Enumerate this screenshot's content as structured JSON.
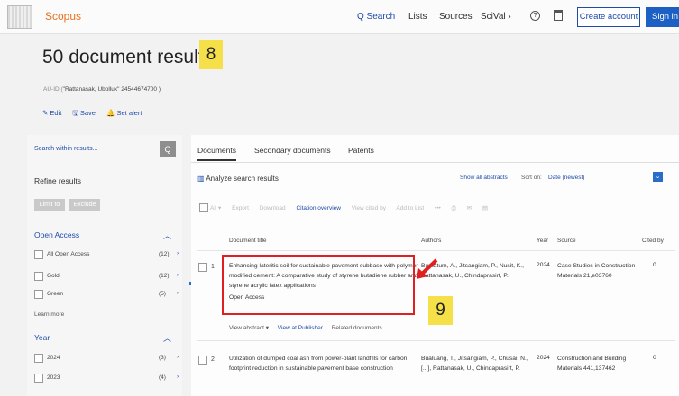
{
  "header": {
    "brand": "Scopus",
    "nav": {
      "search": "Q Search",
      "lists": "Lists",
      "sources": "Sources",
      "scival": "SciVal ›"
    },
    "create_account": "Create account",
    "sign_in": "Sign in"
  },
  "page": {
    "title": "50 document results",
    "step_badge": "8",
    "query_prefix": "AU-ID (",
    "query": "\"Rattanasak, Ubolluk\" 24544674700 )",
    "actions": {
      "edit": "✎ Edit",
      "save": "🖫 Save",
      "set_alert": "🔔 Set alert"
    }
  },
  "sidebar": {
    "search_placeholder": "Search within results...",
    "search_icon": "Q",
    "refine_title": "Refine results",
    "limit_to": "Limit to",
    "exclude": "Exclude",
    "open_access": {
      "title": "Open Access",
      "items": [
        {
          "label": "All Open Access",
          "count": "(12)"
        },
        {
          "label": "Gold",
          "count": "(12)"
        },
        {
          "label": "Green",
          "count": "(5)"
        }
      ]
    },
    "learn_more": "Learn more",
    "year": {
      "title": "Year",
      "items": [
        {
          "label": "2024",
          "count": "(3)"
        },
        {
          "label": "2023",
          "count": "(4)"
        }
      ]
    }
  },
  "results": {
    "tabs": [
      "Documents",
      "Secondary documents",
      "Patents"
    ],
    "analyze": "Analyze search results",
    "show_all_abstracts": "Show all abstracts",
    "sort_on_label": "Sort on:",
    "sort_on_value": "Date (newest)",
    "toolbar": {
      "all": "All ▾",
      "export": "Export",
      "download": "Download",
      "citation_overview": "Citation overview",
      "view_cited_by": "View cited by",
      "add_to_list": "Add to List",
      "more": "•••"
    },
    "columns": {
      "title": "Document title",
      "authors": "Authors",
      "year": "Year",
      "source": "Source",
      "cited_by": "Cited by"
    },
    "rows": [
      {
        "num": "1",
        "title": "Enhancing lateritic soil for sustainable pavement subbase with polymer-modified cement: A comparative study of styrene butadiene rubber and styrene acrylic latex applications",
        "oa": "Open Access",
        "authors": "Buritatum, A., Jitsangiam, P., Nusit, K., Rattanasak, U., Chindaprasirt, P.",
        "year": "2024",
        "source": "Case Studies in Construction Materials 21,e03760",
        "cited_by": "0",
        "view_abstract": "View abstract ▾",
        "view_at_publisher": "View at Publisher",
        "related_documents": "Related documents"
      },
      {
        "num": "2",
        "title": "Utilization of dumped coal ash from power-plant landfills for carbon footprint reduction in sustainable pavement base construction",
        "authors": "Bualuang, T., Jitsangiam, P., Chusai, N., [...], Rattanasak, U., Chindaprasirt, P.",
        "year": "2024",
        "source": "Construction and Building Materials 441,137462",
        "cited_by": "0"
      }
    ],
    "step_badge": "9"
  },
  "colors": {
    "accent": "#1e4aa8",
    "brand": "#e9711c",
    "highlight": "#e02020",
    "badge": "#f5e04a"
  }
}
